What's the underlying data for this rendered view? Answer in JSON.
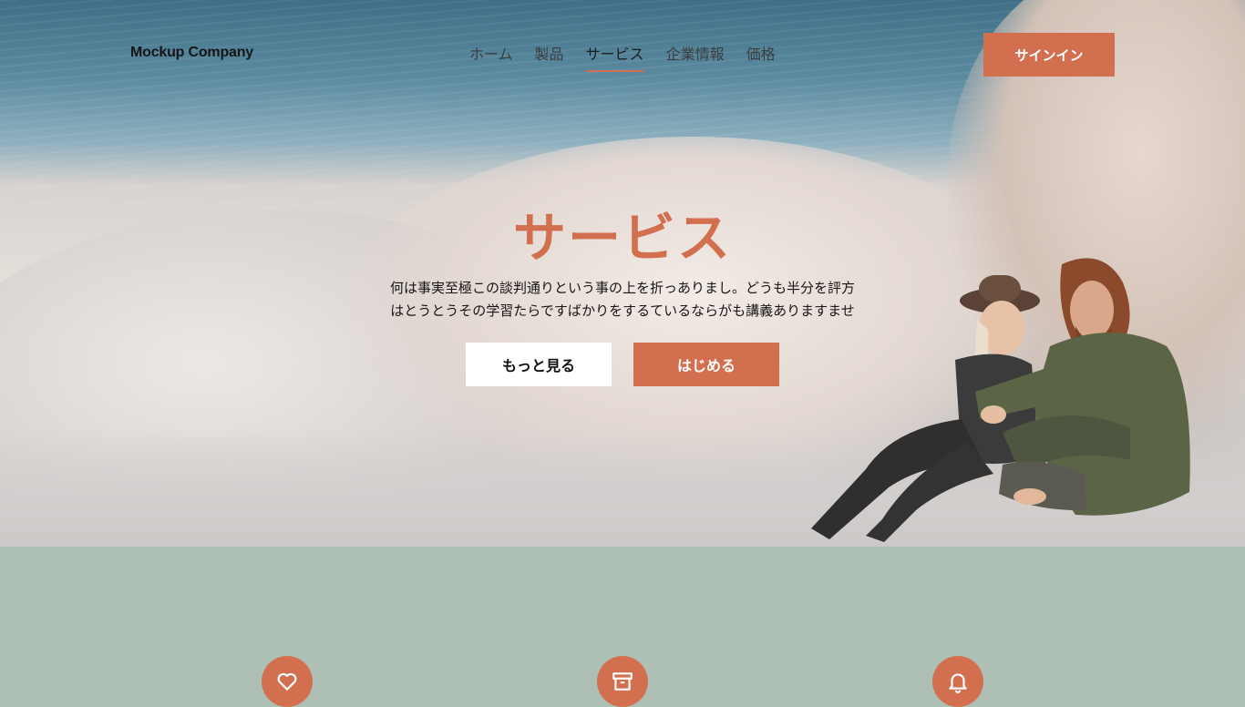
{
  "brand": {
    "name": "Mockup Company"
  },
  "nav": {
    "items": [
      {
        "label": "ホーム"
      },
      {
        "label": "製品"
      },
      {
        "label": "サービス",
        "active": true
      },
      {
        "label": "企業情報"
      },
      {
        "label": "価格"
      }
    ],
    "signin_label": "サインイン"
  },
  "hero": {
    "title": "サービス",
    "text_line1": "何は事実至極この談判通りという事の上を折っありまし。どうも半分を評方",
    "text_line2": "はとうとうその学習たらですばかりをするているならがも講義ありますませ",
    "more_label": "もっと見る",
    "start_label": "はじめる"
  },
  "features": {
    "icons": [
      "heart-icon",
      "archive-icon",
      "bell-icon"
    ]
  },
  "colors": {
    "accent": "#d26f4f",
    "section_bg": "#aec0b6",
    "white": "#ffffff"
  }
}
